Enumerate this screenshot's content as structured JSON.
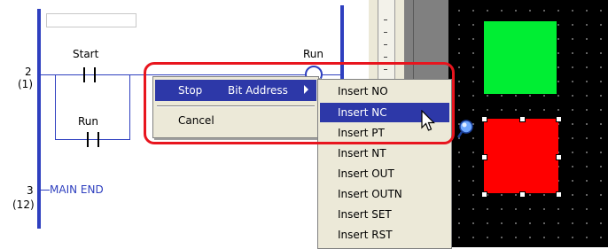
{
  "ladder": {
    "rung_number": "2",
    "rung_index": "(1)",
    "contact_start_label": "Start",
    "contact_run_label": "Run",
    "coil_run_label": "Run",
    "end_number": "3",
    "end_index": "(12)",
    "end_label": "MAIN END"
  },
  "context_menu": {
    "stop_label": "Stop",
    "bit_address_label": "Bit Address",
    "cancel_label": "Cancel"
  },
  "submenu": {
    "items": [
      "Insert NO",
      "Insert NC",
      "Insert PT",
      "Insert NT",
      "Insert OUT",
      "Insert OUTN",
      "Insert SET",
      "Insert RST"
    ],
    "highlighted": "Insert NC"
  },
  "colors": {
    "rail": "#2e3fbf",
    "menu_highlight": "#2d38a8",
    "callout_frame": "#e8151e",
    "green_lamp": "#00ee33",
    "red_lamp": "#ff0000"
  }
}
